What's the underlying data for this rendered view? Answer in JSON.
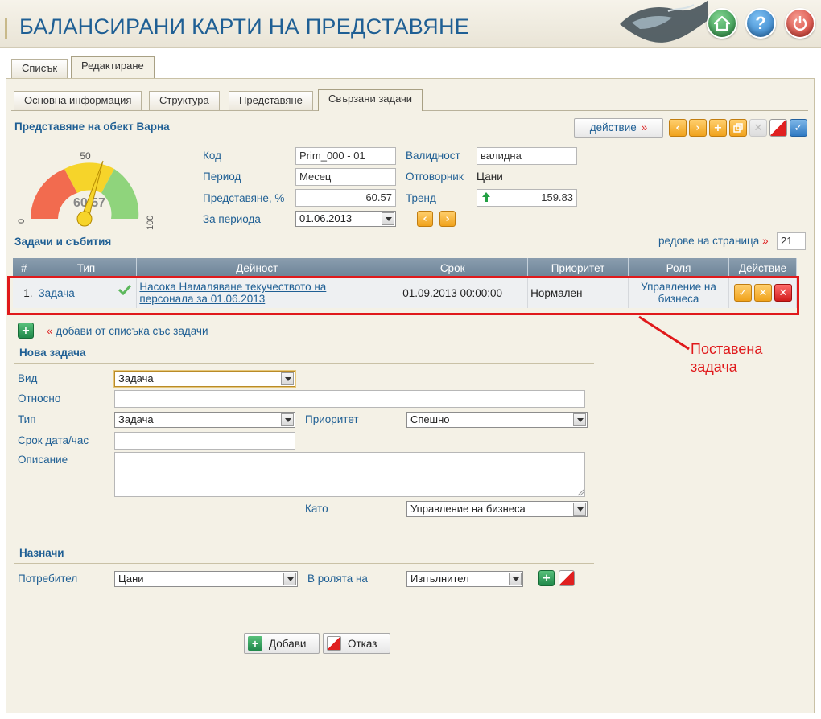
{
  "header": {
    "title": "БАЛАНСИРАНИ КАРТИ НА ПРЕДСТАВЯНЕ",
    "home_icon": "home-icon",
    "help_glyph": "?",
    "power_icon": "power-icon"
  },
  "top_tabs": [
    "Списък",
    "Редактиране"
  ],
  "sub_tabs": [
    "Основна информация",
    "Структура",
    "Представяне",
    "Свързани задачи"
  ],
  "object_title": "Представяне на обект Варна",
  "action_button": {
    "label": "действие",
    "suffix": "»"
  },
  "toolbar_icons": [
    "prev-icon",
    "next-icon",
    "add-icon",
    "copy-icon",
    "delete-icon",
    "cancel-icon",
    "save-icon"
  ],
  "gauge": {
    "min": "0",
    "mid": "50",
    "max": "100",
    "value": 60.57,
    "display": "60.57"
  },
  "info": {
    "code_label": "Код",
    "code_value": "Prim_000 - 01",
    "period_label": "Период",
    "period_value": "Месец",
    "perf_label": "Представяне, %",
    "perf_value": "60.57",
    "for_period_label": "За периода",
    "for_period_value": "01.06.2013",
    "validity_label": "Валидност",
    "validity_value": "валидна",
    "owner_label": "Отговорник",
    "owner_value": "Цани",
    "trend_label": "Тренд",
    "trend_value": "159.83"
  },
  "tasks": {
    "title": "Задачи и събития",
    "rows_per_page_label": "редове на страница",
    "rows_per_page_suffix": "»",
    "rows_per_page_value": "21",
    "columns": [
      "#",
      "Тип",
      "Дейност",
      "Срок",
      "Приоритет",
      "Роля",
      "Действие"
    ],
    "rows": [
      {
        "num": "1.",
        "type": "Задача",
        "activity": "Насока Намаляване текучеството на персонала за 01.06.2013",
        "deadline": "01.09.2013 00:00:00",
        "priority": "Нормален",
        "role": "Управление на бизнеса"
      }
    ],
    "add_from_list_prefix": "«",
    "add_from_list": "добави от списъка със задачи"
  },
  "callout": "Поставена задача",
  "new_task": {
    "title": "Нова задача",
    "kind_label": "Вид",
    "kind_value": "Задача",
    "relative_label": "Относно",
    "relative_value": "",
    "type_label": "Тип",
    "type_value": "Задача",
    "priority_label": "Приоритет",
    "priority_value": "Спешно",
    "deadline_label": "Срок дата/час",
    "deadline_value": "",
    "description_label": "Описание",
    "description_value": "",
    "as_label": "Като",
    "as_value": "Управление на бизнеса"
  },
  "assign": {
    "title": "Назначи",
    "user_label": "Потребител",
    "user_value": "Цани",
    "role_label": "В ролята на",
    "role_value": "Изпълнител"
  },
  "buttons": {
    "add": "Добави",
    "cancel": "Отказ"
  },
  "colors": {
    "title_blue": "#1f5f94",
    "highlight_red": "#e0191b",
    "orange_button": "#f0a21c",
    "gauge_red": "#f26b4f",
    "gauge_yellow": "#f6d42a",
    "gauge_green": "#8fd47c"
  }
}
